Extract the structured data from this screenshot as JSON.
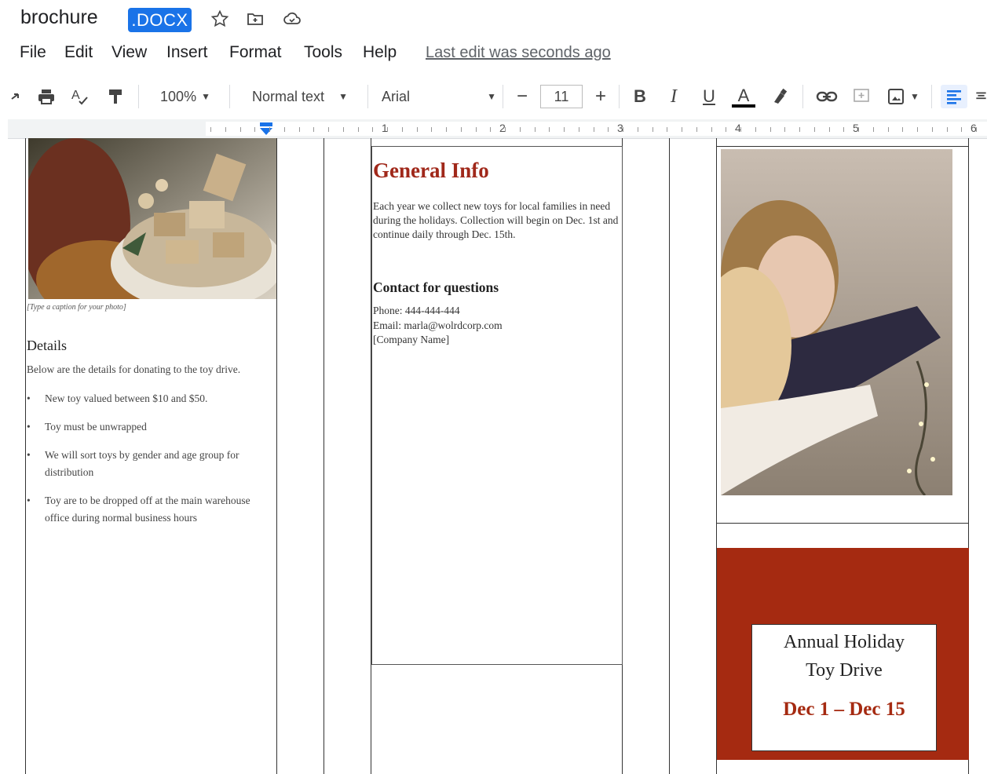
{
  "title_bar": {
    "doc_title": "brochure",
    "badge": ".DOCX",
    "icons": [
      "star-icon",
      "move-to-folder-icon",
      "cloud-status-icon"
    ]
  },
  "menu": {
    "items": [
      "File",
      "Edit",
      "View",
      "Insert",
      "Format",
      "Tools",
      "Help"
    ],
    "last_edit": "Last edit was seconds ago"
  },
  "toolbar": {
    "zoom": "100%",
    "style": "Normal text",
    "font": "Arial",
    "font_size": "11",
    "minus": "−",
    "plus": "+",
    "bold": "B",
    "italic": "I",
    "underline": "U",
    "text_color": "A"
  },
  "ruler": {
    "numbers": [
      "1",
      "2",
      "3",
      "4",
      "5",
      "6"
    ]
  },
  "column1": {
    "caption": "[Type a caption for your photo]",
    "heading": "Details",
    "intro": "Below are the details for donating to the toy drive.",
    "bullets": [
      "New toy valued between $10 and $50.",
      "Toy must be unwrapped",
      "We will sort toys by gender and age group for distribution",
      "Toy are to be dropped off at the main warehouse office during normal business hours"
    ]
  },
  "column2": {
    "heading": "General Info",
    "body": "Each year we collect new toys for local families in need during the holidays.  Collection will begin on Dec. 1st and continue daily through Dec. 15th.",
    "contact_heading": "Contact for questions",
    "phone": "Phone: 444-444-444",
    "email": "Email: marla@wolrdcorp.com",
    "company": "[Company Name]"
  },
  "column3": {
    "card_title_line1": "Annual Holiday",
    "card_title_line2": "Toy Drive",
    "card_dates": "Dec 1 – Dec 15"
  },
  "colors": {
    "accent_red": "#a52a11",
    "heading_red": "#a0281a",
    "badge_blue": "#1a73e8"
  }
}
